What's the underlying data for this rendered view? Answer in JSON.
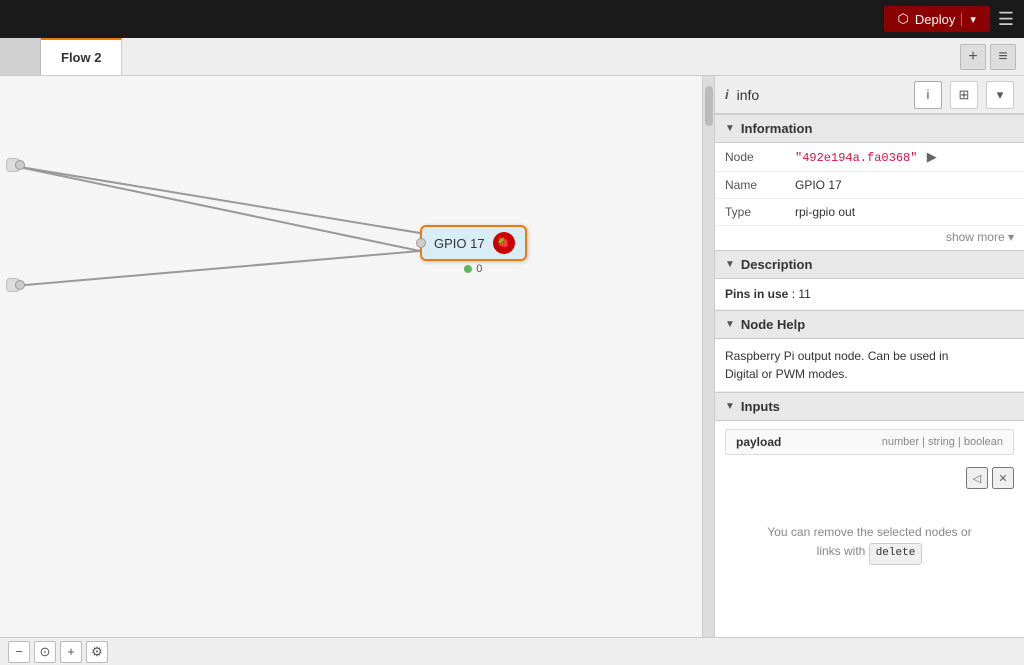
{
  "topbar": {
    "deploy_label": "Deploy",
    "deploy_chevron": "▾",
    "hamburger": "☰"
  },
  "tabs": {
    "inactive_label": "",
    "active_label": "Flow 2",
    "add_icon": "+",
    "list_icon": "≡"
  },
  "panel": {
    "icon": "i",
    "title": "info",
    "info_btn": "i",
    "layout_btn": "⊞",
    "close_btn": "▾"
  },
  "information": {
    "section_title": "Information",
    "node_label": "Node",
    "node_value": "\"492e194a.fa0368\"",
    "name_label": "Name",
    "name_value": "GPIO 17",
    "type_label": "Type",
    "type_value": "rpi-gpio out",
    "show_more": "show more ▾"
  },
  "description": {
    "section_title": "Description",
    "pins_text": "Pins in use",
    "pins_value": ": 11"
  },
  "nodehelp": {
    "section_title": "Node Help",
    "text_line1": "Raspberry Pi output node. Can be used in",
    "text_line2": "Digital or PWM modes."
  },
  "inputs": {
    "section_title": "Inputs",
    "payload_label": "payload",
    "type_label": "number | string | boolean"
  },
  "delete_hint": {
    "line1": "You can remove the selected nodes or",
    "line2": "links with",
    "delete_key": "delete"
  },
  "bottom_toolbar": {
    "zoom_out": "−",
    "zoom_fit": "⊙",
    "zoom_in": "+",
    "settings": "⚙"
  },
  "canvas": {
    "node_label": "GPIO 17",
    "node_count": "0"
  }
}
